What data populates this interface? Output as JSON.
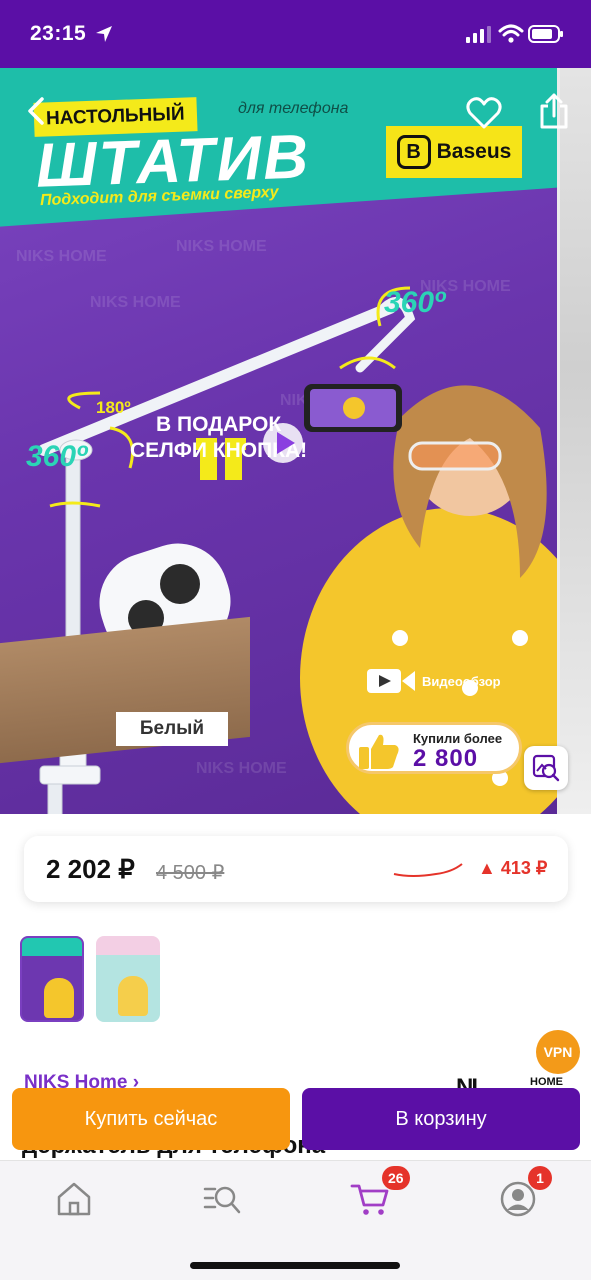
{
  "status_bar": {
    "time": "23:15",
    "icons": [
      "location-arrow-icon",
      "signal-icon",
      "wifi-icon",
      "battery-icon"
    ]
  },
  "gallery": {
    "icons": [
      "back-chevron-icon",
      "heart-icon",
      "share-icon",
      "image-search-icon",
      "play-icon",
      "video-camera-icon",
      "thumbs-up-icon"
    ],
    "banner": {
      "tag": "НАСТОЛЬНЫЙ",
      "for_phone": "для телефона",
      "title": "ШТАТИВ",
      "subtitle": "Подходит для съемки сверху",
      "brand_mark": "B",
      "brand": "Baseus",
      "angle_top": "360º",
      "angle_side": "180º",
      "angle_bottom": "360º",
      "gift_line1": "В ПОДАРОК",
      "gift_line2": "СЕЛФИ КНОПКА!",
      "color_label": "Белый",
      "video_label": "Видеообзор",
      "bought_line1": "Купили более",
      "bought_line2": "2 800",
      "watermark": "NIKS HOME"
    }
  },
  "price": {
    "current": "2 202 ₽",
    "old": "4 500 ₽",
    "drop": "▲ 413 ₽"
  },
  "vpn": "VPN",
  "seller": {
    "link": "NIKS Home ›",
    "logo_big": "NI",
    "logo_small": "HOME"
  },
  "product": {
    "title": "держатель для телефона"
  },
  "actions": {
    "buy_now": "Купить сейчас",
    "to_cart": "В корзину"
  },
  "bottom_nav": {
    "items": [
      "home-icon",
      "catalog-search-icon",
      "cart-icon",
      "profile-icon"
    ],
    "cart_badge": "26",
    "profile_badge": "1"
  },
  "colors": {
    "brand_purple": "#5b0fa6",
    "accent_orange": "#f7960f",
    "price_drop_red": "#e5332a",
    "teal": "#22c7b1",
    "yellow": "#f4ea1a"
  }
}
